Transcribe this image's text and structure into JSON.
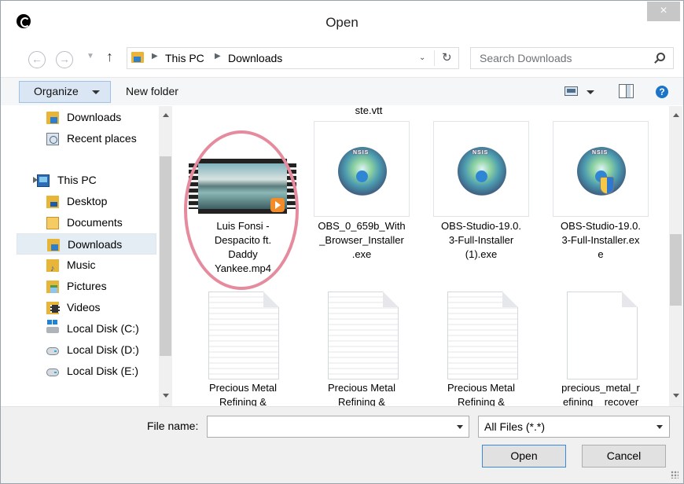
{
  "window": {
    "title": "Open",
    "close_glyph": "×"
  },
  "navigation": {
    "back_glyph": "←",
    "forward_glyph": "→",
    "dropdown_glyph": "▼",
    "up_glyph": "↑",
    "breadcrumbs": [
      "This PC",
      "Downloads"
    ],
    "separator": "▶",
    "address_dropdown_glyph": "⌄",
    "refresh_glyph": "↻",
    "search_placeholder": "Search Downloads"
  },
  "toolbar": {
    "organize_label": "Organize",
    "new_folder_label": "New folder",
    "help_glyph": "?"
  },
  "nav_pane": {
    "items": [
      {
        "label": "Downloads",
        "icon": "downloads-folder-icon"
      },
      {
        "label": "Recent places",
        "icon": "recent-places-icon"
      },
      {
        "label": "This PC",
        "icon": "this-pc-icon"
      },
      {
        "label": "Desktop",
        "icon": "desktop-folder-icon"
      },
      {
        "label": "Documents",
        "icon": "documents-folder-icon"
      },
      {
        "label": "Downloads",
        "icon": "downloads-folder-icon"
      },
      {
        "label": "Music",
        "icon": "music-folder-icon"
      },
      {
        "label": "Pictures",
        "icon": "pictures-folder-icon"
      },
      {
        "label": "Videos",
        "icon": "videos-folder-icon"
      },
      {
        "label": "Local Disk (C:)",
        "icon": "local-disk-c-icon"
      },
      {
        "label": "Local Disk (D:)",
        "icon": "local-disk-icon"
      },
      {
        "label": "Local Disk (E:)",
        "icon": "local-disk-icon"
      }
    ],
    "selected_index": 5
  },
  "files": {
    "top_partial_label": "ste.vtt",
    "row1": [
      {
        "name": "Luis Fonsi - Despacito ft. Daddy Yankee.mp4",
        "lines": [
          "Luis Fonsi -",
          "Despacito ft.",
          "Daddy",
          "Yankee.mp4"
        ],
        "icon": "video-file-icon",
        "highlighted": true
      },
      {
        "name": "OBS_0_659b_With_Browser_Installer.exe",
        "lines": [
          "OBS_0_659b_With",
          "_Browser_Installer",
          ".exe"
        ],
        "icon": "installer-icon"
      },
      {
        "name": "OBS-Studio-19.0.3-Full-Installer (1).exe",
        "lines": [
          "OBS-Studio-19.0.",
          "3-Full-Installer",
          "(1).exe"
        ],
        "icon": "installer-icon"
      },
      {
        "name": "OBS-Studio-19.0.3-Full-Installer.exe",
        "lines": [
          "OBS-Studio-19.0.",
          "3-Full-Installer.ex",
          "e"
        ],
        "icon": "installer-shield-icon"
      }
    ],
    "row2": [
      {
        "lines": [
          "Precious Metal",
          "Refining &"
        ],
        "icon": "text-file-icon"
      },
      {
        "lines": [
          "Precious Metal",
          "Refining &"
        ],
        "icon": "text-file-icon"
      },
      {
        "lines": [
          "Precious Metal",
          "Refining &"
        ],
        "icon": "text-file-icon"
      },
      {
        "lines": [
          "precious_metal_r",
          "efining__recover"
        ],
        "icon": "blank-file-icon"
      }
    ]
  },
  "bottom": {
    "file_name_label": "File name:",
    "file_name_value": "",
    "filter_value": "All Files (*.*)",
    "open_label": "Open",
    "cancel_label": "Cancel"
  },
  "colors": {
    "selection": "#e4ecf4",
    "highlight_ellipse": "#e58b9d",
    "accent": "#3a8ad8"
  }
}
